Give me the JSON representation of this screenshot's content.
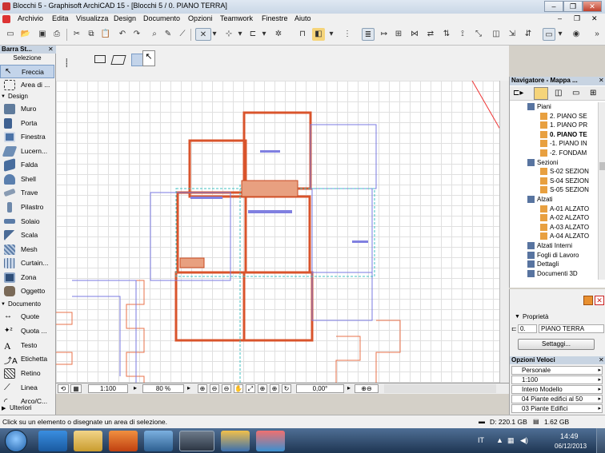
{
  "window": {
    "title": "Blocchi 5 - Graphisoft ArchiCAD 15 - [Blocchi 5 / 0. PIANO TERRA]"
  },
  "menubar": {
    "items": [
      "Archivio",
      "Edita",
      "Visualizza",
      "Design",
      "Documento",
      "Opzioni",
      "Teamwork",
      "Finestre",
      "Aiuto"
    ]
  },
  "toolbox": {
    "title": "Barra St...",
    "selezione_label": "Selezione",
    "selection_tools": [
      {
        "label": "Freccia",
        "icon": "arrow-pointer-icon"
      },
      {
        "label": "Area di ...",
        "icon": "marquee-icon"
      }
    ],
    "design_label": "Design",
    "design_tools": [
      {
        "label": "Muro",
        "icon": "wall-icon"
      },
      {
        "label": "Porta",
        "icon": "door-icon"
      },
      {
        "label": "Finestra",
        "icon": "window-icon"
      },
      {
        "label": "Lucern...",
        "icon": "skylight-icon"
      },
      {
        "label": "Falda",
        "icon": "roof-icon"
      },
      {
        "label": "Shell",
        "icon": "shell-icon"
      },
      {
        "label": "Trave",
        "icon": "beam-icon"
      },
      {
        "label": "Pilastro",
        "icon": "column-icon"
      },
      {
        "label": "Solaio",
        "icon": "slab-icon"
      },
      {
        "label": "Scala",
        "icon": "stair-icon"
      },
      {
        "label": "Mesh",
        "icon": "mesh-icon"
      },
      {
        "label": "Curtain...",
        "icon": "curtain-wall-icon"
      },
      {
        "label": "Zona",
        "icon": "zone-icon"
      },
      {
        "label": "Oggetto",
        "icon": "object-icon"
      }
    ],
    "documento_label": "Documento",
    "document_tools": [
      {
        "label": "Quote",
        "icon": "dimension-icon"
      },
      {
        "label": "Quota ...",
        "icon": "level-dimension-icon"
      },
      {
        "label": "Testo",
        "icon": "text-icon"
      },
      {
        "label": "Etichetta",
        "icon": "label-icon"
      },
      {
        "label": "Retino",
        "icon": "fill-icon"
      },
      {
        "label": "Linea",
        "icon": "line-icon"
      },
      {
        "label": "Arco/C...",
        "icon": "arc-icon"
      }
    ],
    "ulteriori_label": "Ulteriori"
  },
  "canvas_controls": {
    "scale": "1:100",
    "zoom": "80 %",
    "angle": "0,00°"
  },
  "navigator": {
    "title": "Navigatore - Mappa ...",
    "tree": [
      {
        "label": "Piani",
        "level": 1,
        "bold": false,
        "icon": "folder-icon"
      },
      {
        "label": "2. PIANO SE",
        "level": 2,
        "bold": false,
        "icon": "story-icon"
      },
      {
        "label": "1. PIANO PR",
        "level": 2,
        "bold": false,
        "icon": "story-icon"
      },
      {
        "label": "0. PIANO TE",
        "level": 2,
        "bold": true,
        "icon": "story-icon"
      },
      {
        "label": "-1. PIANO IN",
        "level": 2,
        "bold": false,
        "icon": "story-icon"
      },
      {
        "label": "-2. FONDAM",
        "level": 2,
        "bold": false,
        "icon": "story-icon"
      },
      {
        "label": "Sezioni",
        "level": 1,
        "bold": false,
        "icon": "section-folder-icon"
      },
      {
        "label": "S-02 SEZION",
        "level": 2,
        "bold": false,
        "icon": "section-icon"
      },
      {
        "label": "S-04 SEZION",
        "level": 2,
        "bold": false,
        "icon": "section-icon"
      },
      {
        "label": "S-05 SEZION",
        "level": 2,
        "bold": false,
        "icon": "section-icon"
      },
      {
        "label": "Alzati",
        "level": 1,
        "bold": false,
        "icon": "elevation-folder-icon"
      },
      {
        "label": "A-01 ALZATO",
        "level": 2,
        "bold": false,
        "icon": "elevation-icon"
      },
      {
        "label": "A-02 ALZATO",
        "level": 2,
        "bold": false,
        "icon": "elevation-icon"
      },
      {
        "label": "A-03 ALZATO",
        "level": 2,
        "bold": false,
        "icon": "elevation-icon"
      },
      {
        "label": "A-04 ALZATO",
        "level": 2,
        "bold": false,
        "icon": "elevation-icon"
      },
      {
        "label": "Alzati Interni",
        "level": 1,
        "bold": false,
        "icon": "interior-elevation-icon"
      },
      {
        "label": "Fogli di Lavoro",
        "level": 1,
        "bold": false,
        "icon": "worksheet-icon"
      },
      {
        "label": "Dettagli",
        "level": 1,
        "bold": false,
        "icon": "detail-icon"
      },
      {
        "label": "Documenti 3D",
        "level": 1,
        "bold": false,
        "icon": "document-3d-icon"
      }
    ]
  },
  "properties": {
    "header": "Proprietà",
    "story_number": "0.",
    "story_name": "PIANO TERRA",
    "settings_button": "Settaggi..."
  },
  "quick_options": {
    "title": "Opzioni Veloci",
    "items": [
      "Personale",
      "1:100",
      "Intero Modello",
      "04 Piante edifici al 50",
      "03 Piante Edifici"
    ]
  },
  "statusbar": {
    "message": "Click su un elemento o disegnate un area di selezione.",
    "disk": "D: 220.1 GB",
    "memory": "1.62 GB"
  },
  "taskbar": {
    "language": "IT",
    "time": "14:49",
    "date": "06/12/2013"
  }
}
